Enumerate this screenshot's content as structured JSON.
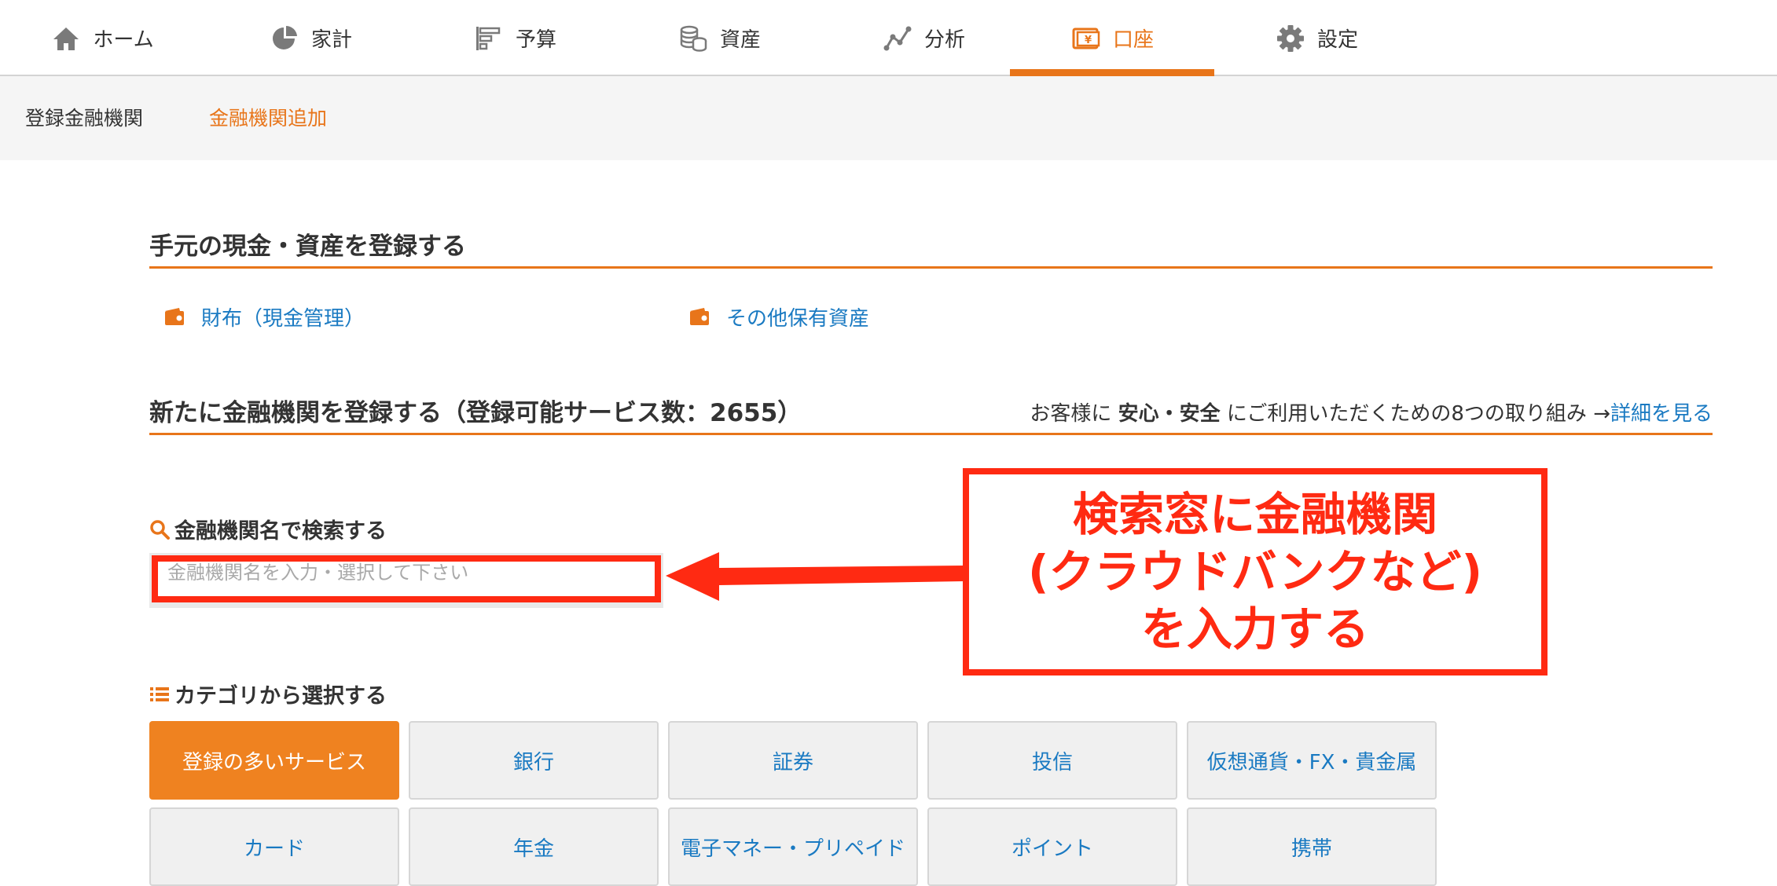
{
  "nav": {
    "items": [
      {
        "label": "ホーム",
        "icon": "home-icon"
      },
      {
        "label": "家計",
        "icon": "pie-chart-icon"
      },
      {
        "label": "予算",
        "icon": "budget-bars-icon"
      },
      {
        "label": "資産",
        "icon": "coin-stack-icon"
      },
      {
        "label": "分析",
        "icon": "line-chart-icon"
      },
      {
        "label": "口座",
        "icon": "wallet-yen-icon"
      },
      {
        "label": "設定",
        "icon": "gear-icon"
      }
    ],
    "active": "口座"
  },
  "subnav": {
    "registered": "登録金融機関",
    "add": "金融機関追加"
  },
  "cash_section": {
    "title": "手元の現金・資産を登録する",
    "links": [
      {
        "label": "財布（現金管理）",
        "icon": "wallet-icon"
      },
      {
        "label": "その他保有資産",
        "icon": "wallet-icon"
      }
    ]
  },
  "institution_section": {
    "title": "新たに金融機関を登録する（登録可能サービス数：2655）",
    "notice_prefix": "お客様に ",
    "notice_bold": "安心・安全",
    "notice_suffix": " にご利用いただくための8つの取り組み →",
    "notice_link": "詳細を見る"
  },
  "search": {
    "label": "金融機関名で検索する",
    "icon": "search-icon",
    "placeholder": "金融機関名を入力・選択して下さい",
    "value": ""
  },
  "annotation": {
    "lines": [
      "検索窓に金融機関",
      "(クラウドバンクなど)",
      "を入力する"
    ],
    "color": "#ff2a12"
  },
  "category": {
    "label": "カテゴリから選択する",
    "icon": "list-icon",
    "row1": [
      "登録の多いサービス",
      "銀行",
      "証券",
      "投信",
      "仮想通貨・FX・貴金属"
    ],
    "row2": [
      "カード",
      "年金",
      "電子マネー・プリペイド",
      "ポイント",
      "携帯"
    ],
    "selected": "登録の多いサービス"
  },
  "colors": {
    "accent": "#e8751a",
    "link": "#1a7ac2",
    "annotation": "#ff2a12"
  }
}
